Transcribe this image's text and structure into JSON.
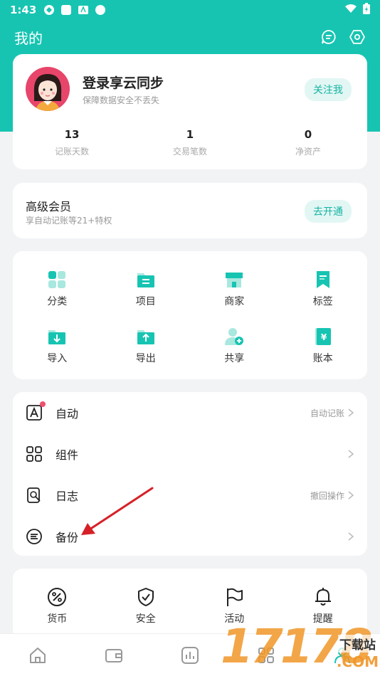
{
  "status_bar": {
    "time": "1:43"
  },
  "header": {
    "title": "我的"
  },
  "profile": {
    "name": "登录享云同步",
    "subtitle": "保障数据安全不丢失",
    "follow_label": "关注我",
    "stats": [
      {
        "value": "13",
        "label": "记账天数"
      },
      {
        "value": "1",
        "label": "交易笔数"
      },
      {
        "value": "0",
        "label": "净资产"
      }
    ]
  },
  "vip": {
    "title": "高级会员",
    "subtitle": "享自动记账等21+特权",
    "button": "去开通"
  },
  "grid": {
    "items": [
      {
        "label": "分类",
        "icon": "category-icon"
      },
      {
        "label": "项目",
        "icon": "project-folder-icon"
      },
      {
        "label": "商家",
        "icon": "store-icon"
      },
      {
        "label": "标签",
        "icon": "bookmark-icon"
      },
      {
        "label": "导入",
        "icon": "import-icon"
      },
      {
        "label": "导出",
        "icon": "export-icon"
      },
      {
        "label": "共享",
        "icon": "share-user-icon"
      },
      {
        "label": "账本",
        "icon": "ledger-icon"
      }
    ]
  },
  "list": {
    "items": [
      {
        "label": "自动",
        "right": "自动记账",
        "icon": "auto-icon"
      },
      {
        "label": "组件",
        "right": "",
        "icon": "widgets-icon"
      },
      {
        "label": "日志",
        "right": "撤回操作",
        "icon": "log-icon"
      },
      {
        "label": "备份",
        "right": "",
        "icon": "backup-icon"
      }
    ]
  },
  "bottom": {
    "items": [
      {
        "label": "货币",
        "icon": "currency-icon"
      },
      {
        "label": "安全",
        "icon": "shield-icon"
      },
      {
        "label": "活动",
        "icon": "flag-icon"
      },
      {
        "label": "提醒",
        "icon": "bell-icon"
      }
    ]
  },
  "watermark": {
    "digits": "17178",
    "top": "下载站",
    "bottom": ".COM"
  },
  "colors": {
    "accent": "#17c4b2",
    "accent_light": "#e2f7f4",
    "badge": "#f0506e",
    "arrow": "#d62027"
  }
}
